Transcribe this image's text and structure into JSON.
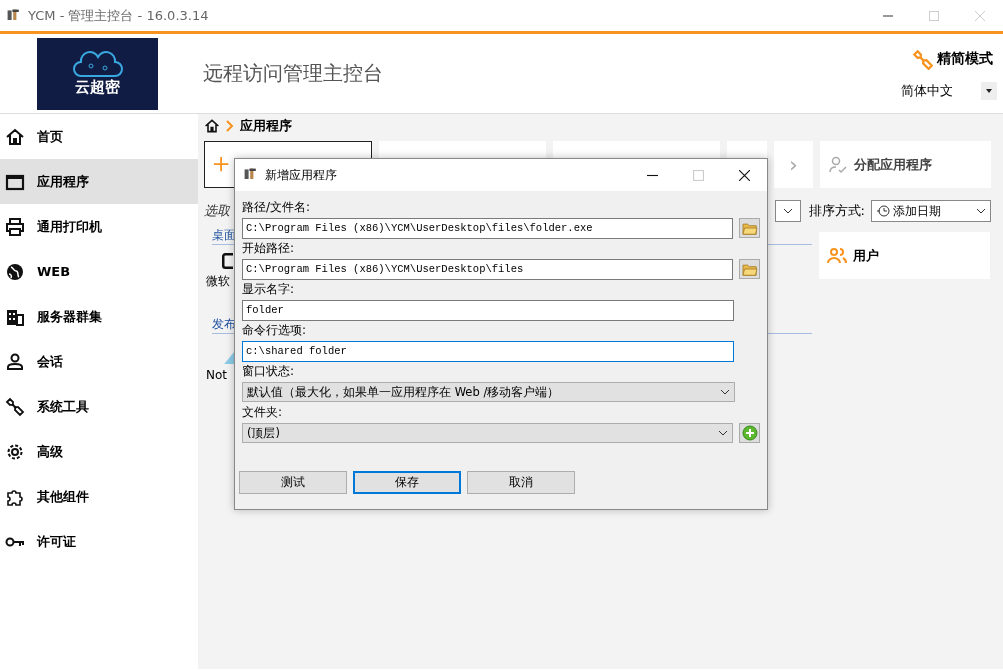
{
  "window": {
    "title": "YCM - 管理主控台 - 16.0.3.14"
  },
  "header": {
    "logo_text": "云超密",
    "title": "远程访问管理主控台",
    "mode_button": "精简模式",
    "language": "简体中文"
  },
  "sidebar": {
    "items": [
      {
        "label": "首页",
        "selected": false
      },
      {
        "label": "应用程序",
        "selected": true
      },
      {
        "label": "通用打印机",
        "selected": false
      },
      {
        "label": "WEB",
        "selected": false
      },
      {
        "label": "服务器群集",
        "selected": false
      },
      {
        "label": "会话",
        "selected": false
      },
      {
        "label": "系统工具",
        "selected": false
      },
      {
        "label": "高级",
        "selected": false
      },
      {
        "label": "其他组件",
        "selected": false
      },
      {
        "label": "许可证",
        "selected": false
      }
    ]
  },
  "breadcrumb": {
    "current": "应用程序"
  },
  "toolbar": {
    "next": "›",
    "assign": "分配应用程序"
  },
  "sort": {
    "label": "排序方式:",
    "value": "添加日期"
  },
  "background": {
    "select_label": "选取",
    "desktop_section": "桌面",
    "desktop_app": "微软",
    "publish_section": "发布",
    "publish_app": "Not"
  },
  "users_card": {
    "title": "用户"
  },
  "dialog": {
    "title": "新增应用程序",
    "fields": [
      {
        "kind": "path",
        "label": "路径/文件名:",
        "value": "C:\\Program Files (x86)\\YCM\\UserDesktop\\files\\folder.exe",
        "focused": false
      },
      {
        "kind": "path",
        "label": "开始路径:",
        "value": "C:\\Program Files (x86)\\YCM\\UserDesktop\\files",
        "focused": false
      },
      {
        "kind": "text",
        "label": "显示名字:",
        "value": "folder",
        "focused": false
      },
      {
        "kind": "text",
        "label": "命令行选项:",
        "value": "c:\\shared folder",
        "focused": true
      },
      {
        "kind": "select",
        "label": "窗口状态:",
        "value": "默认值（最大化，如果单一应用程序在 Web /移动客户端）"
      },
      {
        "kind": "folder",
        "label": "文件夹:",
        "value": "(顶层)"
      }
    ],
    "buttons": [
      {
        "label": "测试",
        "kind": "left",
        "default": false
      },
      {
        "label": "保存",
        "kind": "right",
        "default": true
      },
      {
        "label": "取消",
        "kind": "right",
        "default": false
      }
    ]
  }
}
